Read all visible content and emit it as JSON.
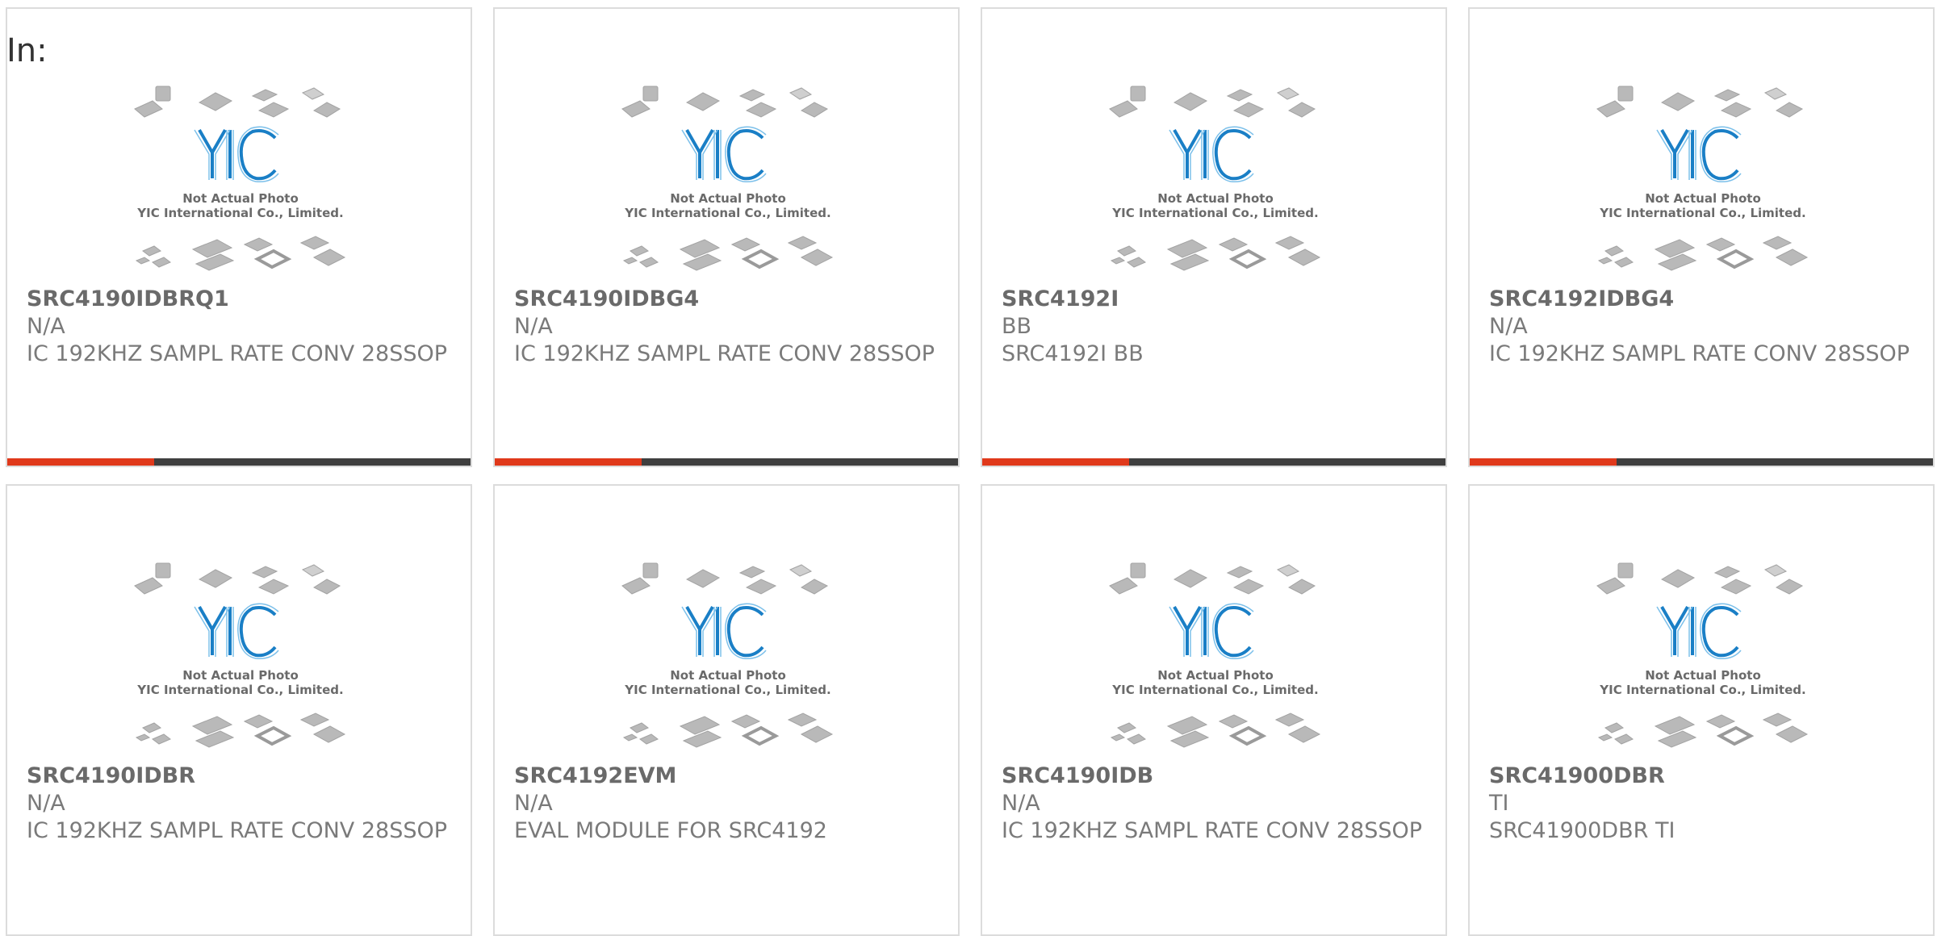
{
  "filter_label": "In:",
  "placeholder_image": {
    "caption_line1": "Not Actual Photo",
    "caption_line2": "YIC International Co., Limited.",
    "logo_text": "YIC"
  },
  "colors": {
    "accent": "#e0391b",
    "bar": "#3f3f3f",
    "logo_blue": "#1a7fc6"
  },
  "products": [
    {
      "part": "SRC4190IDBRQ1",
      "mfr": "N/A",
      "desc": "IC 192KHZ SAMPL RATE CONV 28SSOP"
    },
    {
      "part": "SRC4190IDBG4",
      "mfr": "N/A",
      "desc": "IC 192KHZ SAMPL RATE CONV 28SSOP"
    },
    {
      "part": "SRC4192I",
      "mfr": "BB",
      "desc": "SRC4192I BB"
    },
    {
      "part": "SRC4192IDBG4",
      "mfr": "N/A",
      "desc": "IC 192KHZ SAMPL RATE CONV 28SSOP"
    },
    {
      "part": "SRC4190IDBR",
      "mfr": "N/A",
      "desc": "IC 192KHZ SAMPL RATE CONV 28SSOP"
    },
    {
      "part": "SRC4192EVM",
      "mfr": "N/A",
      "desc": "EVAL MODULE FOR SRC4192"
    },
    {
      "part": "SRC4190IDB",
      "mfr": "N/A",
      "desc": "IC 192KHZ SAMPL RATE CONV 28SSOP"
    },
    {
      "part": "SRC41900DBR",
      "mfr": "TI",
      "desc": "SRC41900DBR TI"
    }
  ]
}
